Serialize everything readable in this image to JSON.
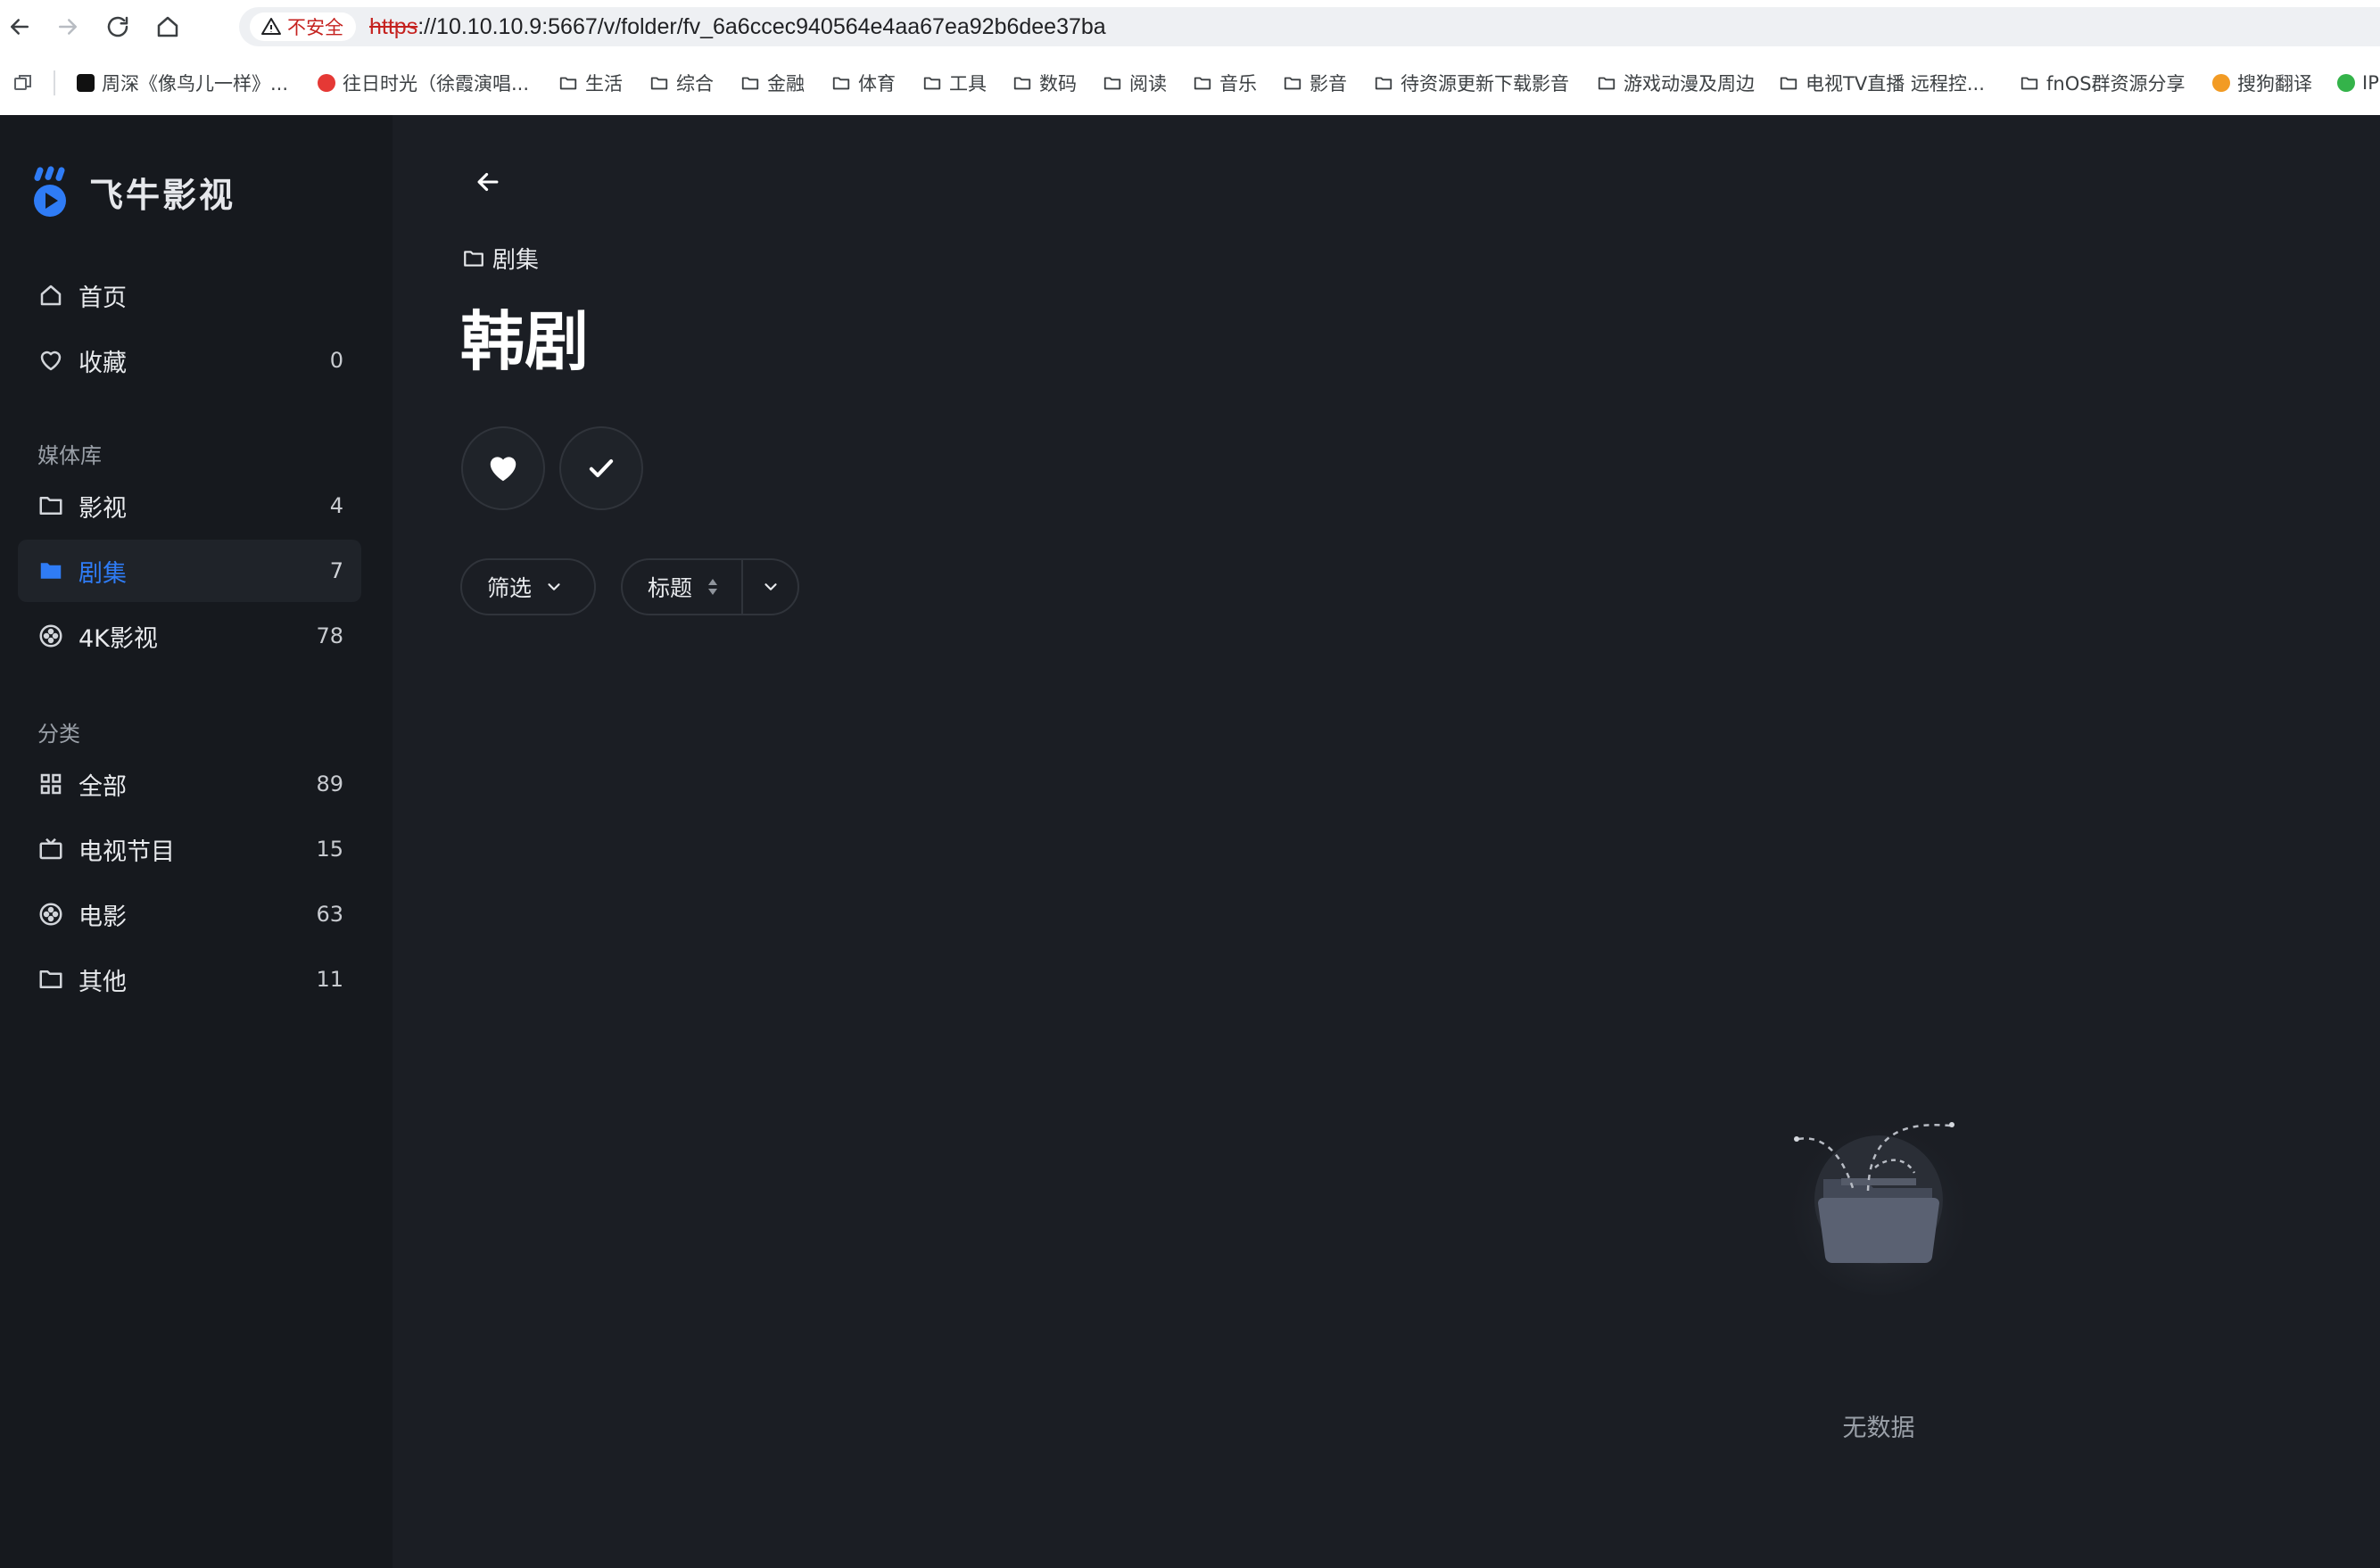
{
  "browser": {
    "security_label": "不安全",
    "url_scheme": "https",
    "url_rest": "://10.10.10.9:5667/v/folder/fv_6a6ccec940564e4aa67ea92b6dee37ba",
    "bookmarks": [
      {
        "label": "周深《像鸟儿一样》...",
        "icon": "tiktok-favicon"
      },
      {
        "label": "往日时光（徐霞演唱...",
        "icon": "red-favicon"
      },
      {
        "label": "生活",
        "icon": "folder-icon"
      },
      {
        "label": "综合",
        "icon": "folder-icon"
      },
      {
        "label": "金融",
        "icon": "folder-icon"
      },
      {
        "label": "体育",
        "icon": "folder-icon"
      },
      {
        "label": "工具",
        "icon": "folder-icon"
      },
      {
        "label": "数码",
        "icon": "folder-icon"
      },
      {
        "label": "阅读",
        "icon": "folder-icon"
      },
      {
        "label": "音乐",
        "icon": "folder-icon"
      },
      {
        "label": "影音",
        "icon": "folder-icon"
      },
      {
        "label": "待资源更新下载影音",
        "icon": "folder-icon"
      },
      {
        "label": "游戏动漫及周边",
        "icon": "folder-icon"
      },
      {
        "label": "电视TV直播 远程控...",
        "icon": "folder-icon"
      },
      {
        "label": "fnOS群资源分享",
        "icon": "folder-icon"
      },
      {
        "label": "搜狗翻译",
        "icon": "sogou-favicon"
      },
      {
        "label": "IP",
        "icon": "green-check-favicon"
      }
    ]
  },
  "app": {
    "logo_text": "飞牛影视",
    "nav": {
      "home": {
        "label": "首页",
        "icon": "home-icon"
      },
      "favorites": {
        "label": "收藏",
        "count": "0",
        "icon": "heart-icon"
      }
    },
    "library_section": "媒体库",
    "libraries": [
      {
        "label": "影视",
        "count": "4",
        "icon": "folder-icon"
      },
      {
        "label": "剧集",
        "count": "7",
        "icon": "folder-filled-icon",
        "active": true
      },
      {
        "label": "4K影视",
        "count": "78",
        "icon": "film-reel-icon"
      }
    ],
    "category_section": "分类",
    "categories": [
      {
        "label": "全部",
        "count": "89",
        "icon": "grid-icon"
      },
      {
        "label": "电视节目",
        "count": "15",
        "icon": "tv-icon"
      },
      {
        "label": "电影",
        "count": "63",
        "icon": "film-reel-icon"
      },
      {
        "label": "其他",
        "count": "11",
        "icon": "folder-icon"
      }
    ],
    "accent_color": "#2f7cf6"
  },
  "main": {
    "breadcrumb": "剧集",
    "title": "韩剧",
    "filter_label": "筛选",
    "sort_label": "标题",
    "empty_text": "无数据"
  }
}
